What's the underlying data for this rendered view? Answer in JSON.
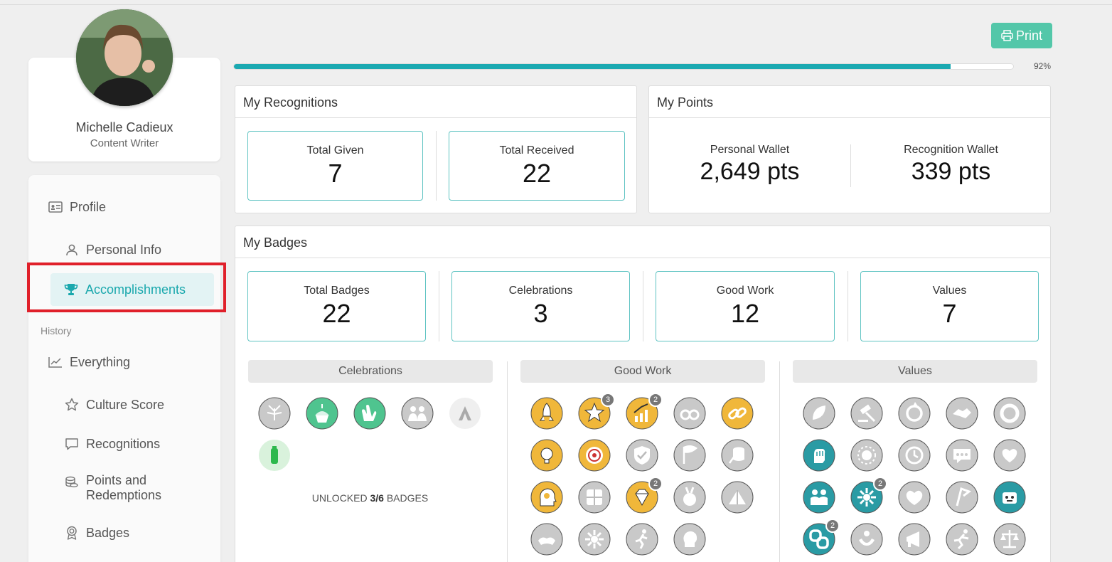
{
  "profile": {
    "name": "Michelle Cadieux",
    "role": "Content Writer"
  },
  "nav": {
    "profile": "Profile",
    "personal_info": "Personal Info",
    "accomplishments": "Accomplishments",
    "history": "History",
    "everything": "Everything",
    "culture_score": "Culture Score",
    "recognitions": "Recognitions",
    "points_line1": "Points and",
    "points_line2": "Redemptions",
    "badges": "Badges"
  },
  "print_label": "Print",
  "progress": {
    "value": 92,
    "label": "92%"
  },
  "recognitions": {
    "title": "My Recognitions",
    "given_label": "Total Given",
    "given": "7",
    "received_label": "Total Received",
    "received": "22"
  },
  "points": {
    "title": "My Points",
    "personal_label": "Personal Wallet",
    "personal": "2,649 pts",
    "recognition_label": "Recognition Wallet",
    "recognition": "339 pts"
  },
  "badges": {
    "title": "My Badges",
    "stats": [
      {
        "label": "Total Badges",
        "value": "22"
      },
      {
        "label": "Celebrations",
        "value": "3"
      },
      {
        "label": "Good Work",
        "value": "12"
      },
      {
        "label": "Values",
        "value": "7"
      }
    ],
    "categories": [
      "Celebrations",
      "Good Work",
      "Values"
    ],
    "unlocked_prefix": "UNLOCKED",
    "unlocked_count": "3/6",
    "unlocked_suffix": "BADGES",
    "counts": {
      "gw_star": "3",
      "gw_growth": "2",
      "gw_diamond": "2",
      "v_team": "2",
      "v_knot": "2"
    }
  },
  "colors": {
    "accent": "#1aa8ad",
    "gold": "#f0b73a",
    "teal_badge": "#2a9ba4",
    "green_badge": "#4fc48f",
    "grey_badge": "#c9c9c9",
    "print": "#53c7a9"
  }
}
